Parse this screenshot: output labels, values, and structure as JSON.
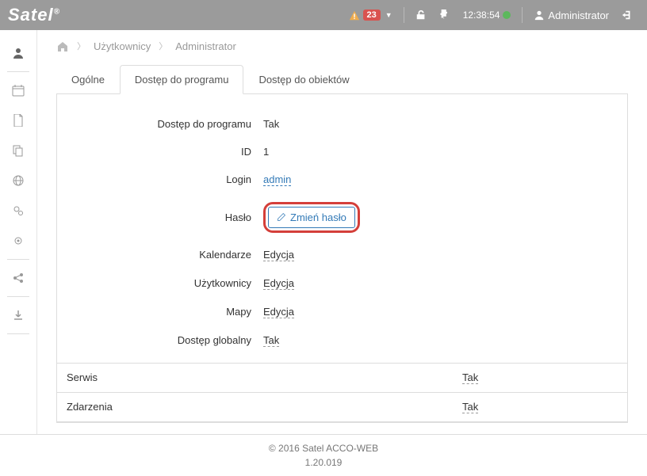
{
  "header": {
    "logo": "Satel",
    "alert_count": "23",
    "time": "12:38:54",
    "username": "Administrator"
  },
  "breadcrumb": {
    "level1": "Użytkownicy",
    "level2": "Administrator"
  },
  "tabs": {
    "general": "Ogólne",
    "program_access": "Dostęp do programu",
    "object_access": "Dostęp do obiektów"
  },
  "form": {
    "program_access_label": "Dostęp do programu",
    "program_access_value": "Tak",
    "id_label": "ID",
    "id_value": "1",
    "login_label": "Login",
    "login_value": "admin",
    "password_label": "Hasło",
    "change_password_btn": "Zmień hasło",
    "calendars_label": "Kalendarze",
    "calendars_value": "Edycja",
    "users_label": "Użytkownicy",
    "users_value": "Edycja",
    "maps_label": "Mapy",
    "maps_value": "Edycja",
    "global_access_label": "Dostęp globalny",
    "global_access_value": "Tak"
  },
  "table": {
    "service_label": "Serwis",
    "service_value": "Tak",
    "events_label": "Zdarzenia",
    "events_value": "Tak"
  },
  "footer": {
    "copyright": "© 2016 Satel ACCO-WEB",
    "version": "1.20.019"
  }
}
